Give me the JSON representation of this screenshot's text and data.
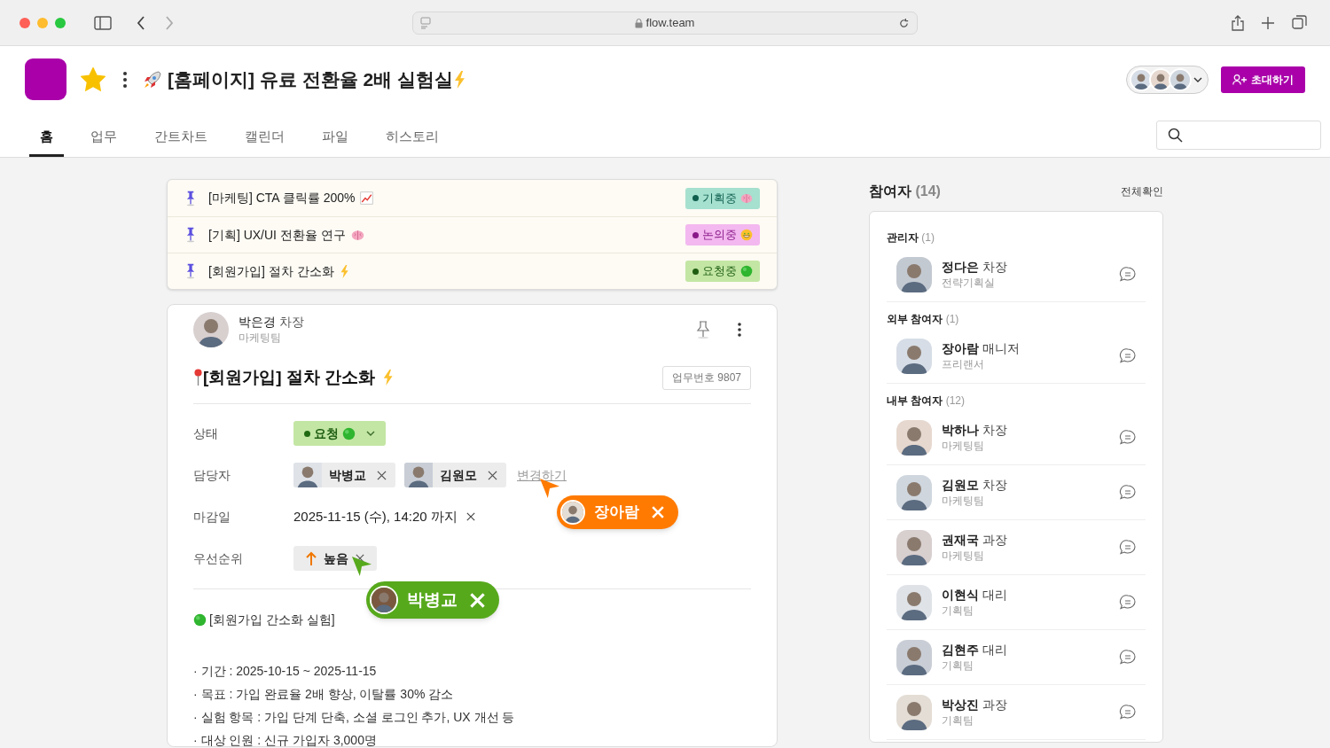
{
  "browser": {
    "url": "flow.team"
  },
  "project": {
    "title": "[홈페이지] 유료 전환율 2배 실험실",
    "starred": true,
    "invite_button": "초대하기"
  },
  "tabs": [
    {
      "label": "홈",
      "selected": true
    },
    {
      "label": "업무",
      "selected": false
    },
    {
      "label": "간트차트",
      "selected": false
    },
    {
      "label": "캘린더",
      "selected": false
    },
    {
      "label": "파일",
      "selected": false
    },
    {
      "label": "히스토리",
      "selected": false
    }
  ],
  "pinned": [
    {
      "title": "[마케팅] CTA 클릭률 200%",
      "status": "기획중",
      "color": "#0f5e4e"
    },
    {
      "title": "[기획] UX/UI 전환율 연구",
      "status": "논의중",
      "color": "#8a1a8a"
    },
    {
      "title": "[회원가입] 절차 간소화",
      "status": "요청중",
      "color": "#1f5e12"
    }
  ],
  "post": {
    "author": {
      "name": "박은경",
      "position": "차장",
      "team": "마케팅팀"
    },
    "title": "[회원가입] 절차 간소화",
    "task_number": "업무번호 9807",
    "status_label": "상태",
    "status": "요청",
    "assignee_label": "담당자",
    "assignees": [
      "박병교",
      "김원모"
    ],
    "change_link": "변경하기",
    "deadline_label": "마감일",
    "deadline": "2025-11-15 (수), 14:20 까지",
    "priority_label": "우선순위",
    "priority": "높음",
    "body_heading": "[회원가입 간소화 실험]",
    "bullets": [
      "· 기간 : 2025-10-15 ~ 2025-11-15",
      "· 목표 : 가입 완료율 2배 향상, 이탈률 30% 감소",
      "· 실험 항목 : 가입 단계 단축, 소셜 로그인 추가, UX 개선 등",
      "· 대상 인원 : 신규 가입자 3,000명"
    ]
  },
  "cursors": [
    {
      "name": "장아람",
      "color": "#ff7a00"
    },
    {
      "name": "박병교",
      "color": "#57a91c"
    }
  ],
  "participants": {
    "title": "참여자",
    "count": "(14)",
    "view_all": "전체확인",
    "groups": [
      {
        "label": "관리자",
        "count": "(1)",
        "members": [
          {
            "name": "정다은",
            "position": "차장",
            "team": "전략기획실"
          }
        ]
      },
      {
        "label": "외부 참여자",
        "count": "(1)",
        "members": [
          {
            "name": "장아람",
            "position": "매니저",
            "team": "프리랜서"
          }
        ]
      },
      {
        "label": "내부 참여자",
        "count": "(12)",
        "members": [
          {
            "name": "박하나",
            "position": "차장",
            "team": "마케팅팀"
          },
          {
            "name": "김원모",
            "position": "차장",
            "team": "마케팅팀"
          },
          {
            "name": "권재국",
            "position": "과장",
            "team": "마케팅팀"
          },
          {
            "name": "이현식",
            "position": "대리",
            "team": "기획팀"
          },
          {
            "name": "김현주",
            "position": "대리",
            "team": "기획팀"
          },
          {
            "name": "박상진",
            "position": "과장",
            "team": "기획팀"
          }
        ]
      }
    ]
  }
}
